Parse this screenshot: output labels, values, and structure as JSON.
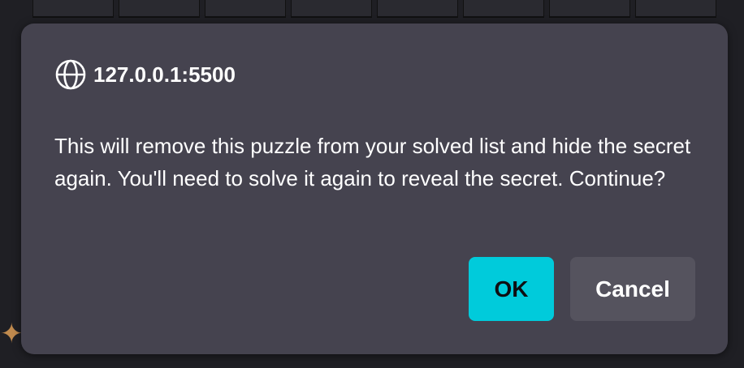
{
  "dialog": {
    "origin": "127.0.0.1:5500",
    "origin_icon": "globe-icon",
    "message": "This will remove this puzzle from your solved list and hide the secret again. You'll need to solve it again to reveal the secret. Continue?",
    "ok_label": "OK",
    "cancel_label": "Cancel"
  },
  "background": {
    "deco_icon": "sparkle-icon"
  },
  "colors": {
    "dialog_bg": "#45434f",
    "ok_bg": "#00cbdb",
    "cancel_bg": "#55535e",
    "text": "#ffffff"
  }
}
